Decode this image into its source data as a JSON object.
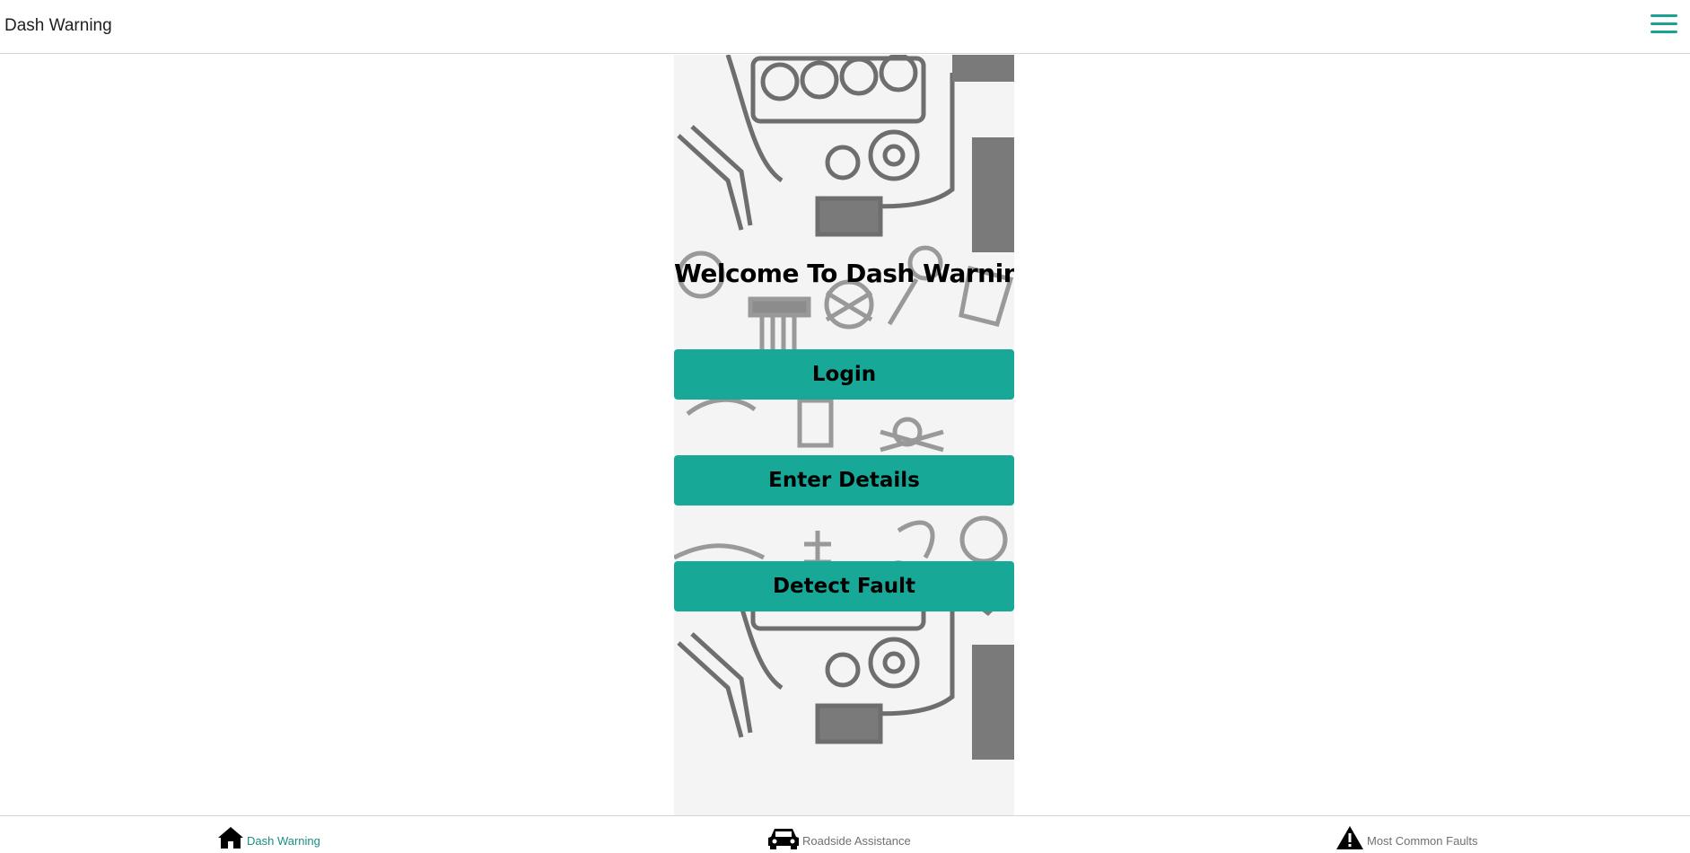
{
  "header": {
    "app_title": "Dash Warning",
    "menu_icon": "hamburger-menu-icon",
    "accent_color": "#1aa394"
  },
  "main": {
    "welcome_title": "Welcome To Dash Warning",
    "buttons": [
      {
        "label": "Login"
      },
      {
        "label": "Enter Details"
      },
      {
        "label": "Detect Fault"
      }
    ],
    "button_color": "#17a898"
  },
  "bottom_nav": {
    "items": [
      {
        "label": "Dash Warning",
        "icon": "home-icon",
        "active": true
      },
      {
        "label": "Roadside Assistance",
        "icon": "car-icon",
        "active": false
      },
      {
        "label": "Most Common Faults",
        "icon": "warning-icon",
        "active": false
      }
    ],
    "active_color": "#1a8f84",
    "inactive_color": "#707070"
  }
}
